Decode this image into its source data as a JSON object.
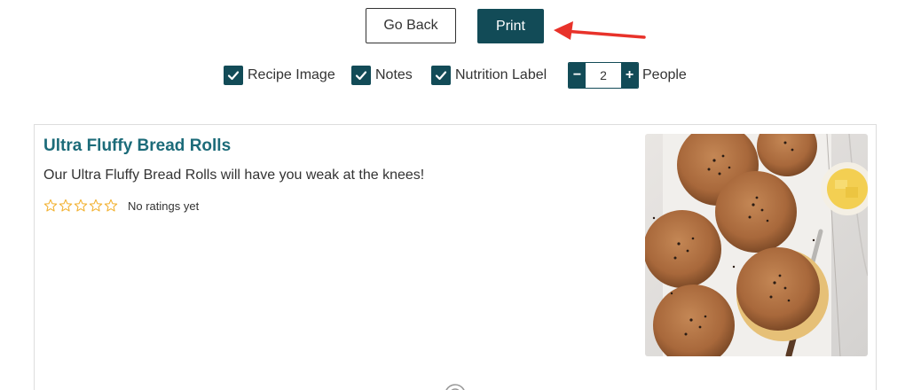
{
  "actions": {
    "go_back_label": "Go Back",
    "print_label": "Print"
  },
  "options": {
    "recipe_image": {
      "label": "Recipe Image",
      "checked": true
    },
    "notes": {
      "label": "Notes",
      "checked": true
    },
    "nutrition_label": {
      "label": "Nutrition Label",
      "checked": true
    },
    "servings": {
      "decrement": "−",
      "value": "2",
      "increment": "+",
      "unit_label": "People"
    }
  },
  "recipe": {
    "title": "Ultra Fluffy Bread Rolls",
    "summary": "Our Ultra Fluffy Bread Rolls will have you weak at the knees!",
    "rating": {
      "stars_filled": 0,
      "stars_total": 5,
      "text": "No ratings yet"
    }
  },
  "colors": {
    "primary": "#124b57",
    "title": "#1c6b79",
    "star": "#f2b233",
    "annotation_arrow": "#e8322a"
  }
}
